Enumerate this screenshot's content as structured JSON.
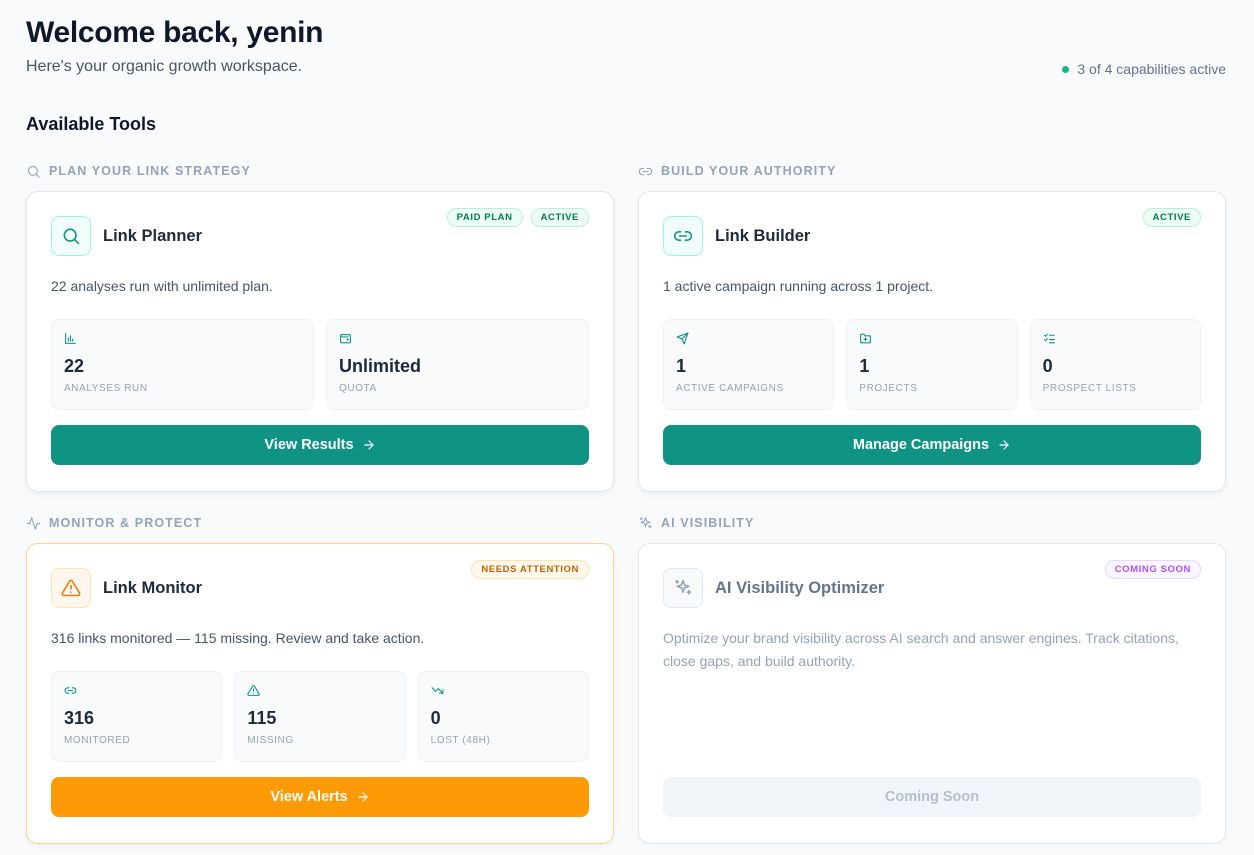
{
  "header": {
    "welcome": "Welcome back, yenin",
    "subtitle": "Here's your organic growth workspace.",
    "capabilities": "3 of 4 capabilities active"
  },
  "tools_title": "Available Tools",
  "colors": {
    "teal": "#0e9384",
    "orange": "#fd9a05",
    "active_dot": "#10b981",
    "purple": "#a855f7"
  },
  "sections": [
    {
      "label": "PLAN YOUR LINK STRATEGY",
      "icon": "search-icon",
      "card": {
        "name": "Link Planner",
        "icon": "search-icon",
        "badges": [
          "PAID PLAN",
          "ACTIVE"
        ],
        "description": "22 analyses run with unlimited plan.",
        "stats": [
          {
            "icon": "bar-chart-icon",
            "value": "22",
            "label": "ANALYSES RUN"
          },
          {
            "icon": "wallet-icon",
            "value": "Unlimited",
            "label": "QUOTA"
          }
        ],
        "button": "View Results"
      }
    },
    {
      "label": "BUILD YOUR AUTHORITY",
      "icon": "link-icon",
      "card": {
        "name": "Link Builder",
        "icon": "link-icon",
        "badges": [
          "ACTIVE"
        ],
        "description": "1 active campaign running across 1 project.",
        "stats": [
          {
            "icon": "send-icon",
            "value": "1",
            "label": "ACTIVE CAMPAIGNS"
          },
          {
            "icon": "folder-plus-icon",
            "value": "1",
            "label": "PROJECTS"
          },
          {
            "icon": "list-checks-icon",
            "value": "0",
            "label": "PROSPECT LISTS"
          }
        ],
        "button": "Manage Campaigns"
      }
    },
    {
      "label": "MONITOR & PROTECT",
      "icon": "activity-icon",
      "card": {
        "name": "Link Monitor",
        "icon": "alert-triangle-icon",
        "badges": [
          "NEEDS ATTENTION"
        ],
        "description": "316 links monitored — 115 missing. Review and take action.",
        "stats": [
          {
            "icon": "link-icon",
            "value": "316",
            "label": "MONITORED"
          },
          {
            "icon": "alert-triangle-icon",
            "value": "115",
            "label": "MISSING"
          },
          {
            "icon": "trending-down-icon",
            "value": "0",
            "label": "LOST (48H)"
          }
        ],
        "button": "View Alerts"
      }
    },
    {
      "label": "AI VISIBILITY",
      "icon": "sparkles-icon",
      "card": {
        "name": "AI Visibility Optimizer",
        "icon": "sparkles-icon",
        "badges": [
          "COMING SOON"
        ],
        "description": "Optimize your brand visibility across AI search and answer engines. Track citations, close gaps, and build authority.",
        "button": "Coming Soon"
      }
    }
  ]
}
